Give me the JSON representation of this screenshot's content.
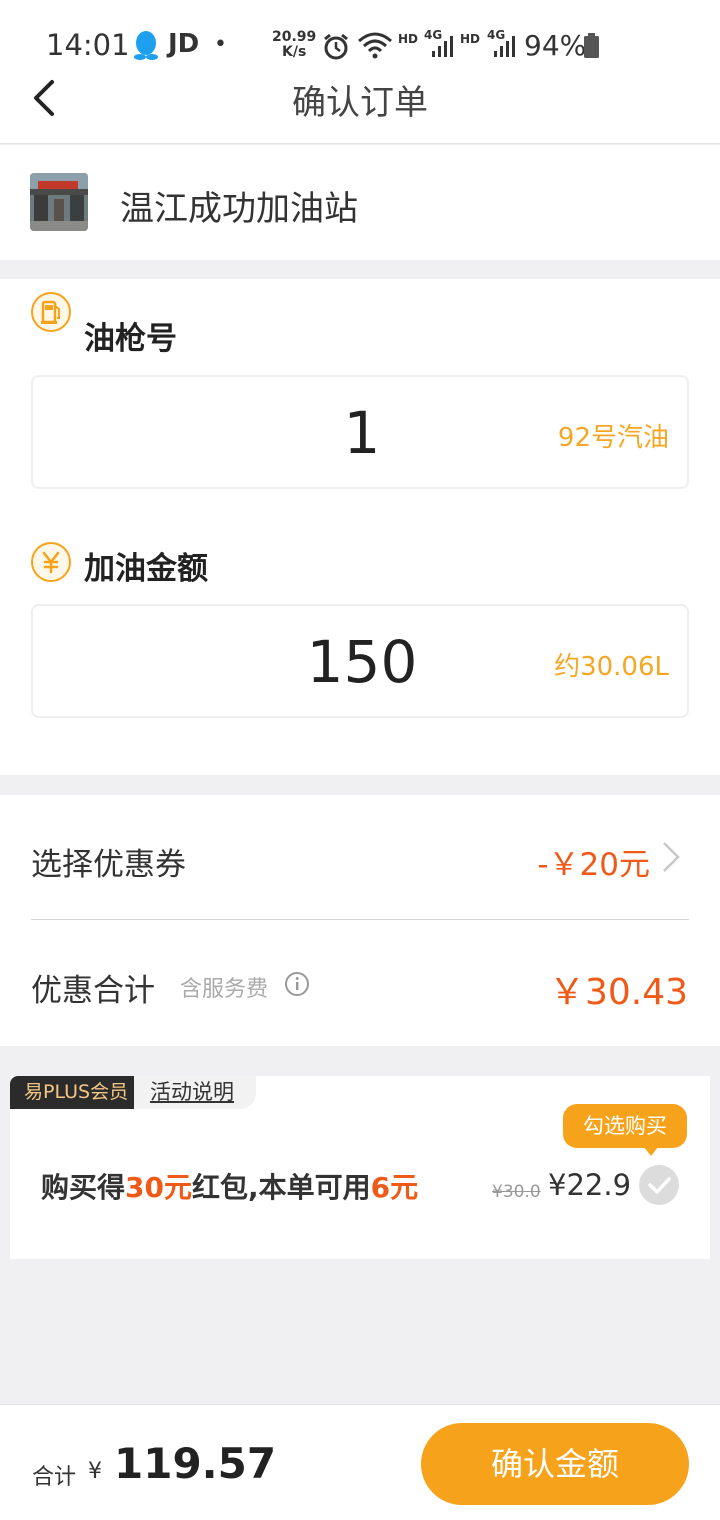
{
  "status_bar": {
    "time": "14:01",
    "jd": "JD",
    "dot": "•",
    "speed_value": "20.99",
    "speed_unit": "K/s",
    "net1": "HD",
    "net1_type": "4G",
    "net2": "HD",
    "net2_type": "4G",
    "battery": "94%"
  },
  "nav": {
    "title": "确认订单"
  },
  "station": {
    "name": "温江成功加油站"
  },
  "nozzle": {
    "label": "油枪号",
    "value": "1",
    "fuel_type": "92号汽油"
  },
  "amount": {
    "label": "加油金额",
    "value": "150",
    "liters": "约30.06L"
  },
  "coupon": {
    "label": "选择优惠券",
    "value": "-￥20元"
  },
  "discount_total": {
    "label": "优惠合计",
    "note": "含服务费",
    "value": "￥30.43"
  },
  "plus": {
    "badge": "易PLUS会员",
    "desc_link": "活动说明",
    "promo_prefix": "购买得",
    "promo_amount1": "30元",
    "promo_middle": "红包,本单可用",
    "promo_amount2": "6元",
    "old_price": "¥30.0",
    "new_price": "¥22.9",
    "buy_tip": "勾选购买"
  },
  "footer": {
    "sum_label": "合计",
    "currency": "¥",
    "sum_amount": "119.57",
    "confirm_label": "确认金额"
  },
  "colors": {
    "accent_orange": "#f7a21b",
    "price_red": "#f05a18",
    "hint_orange": "#f5a623"
  }
}
